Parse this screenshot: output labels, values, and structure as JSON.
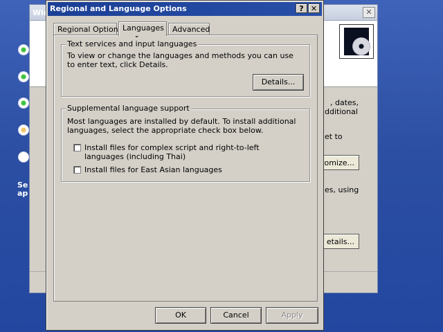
{
  "background_window": {
    "title": "Win",
    "close_glyph": "✕",
    "text_lines": [
      ", dates,",
      "dditional",
      "et to"
    ],
    "customize_label": "stomize...",
    "using_text": "es, using",
    "details_label": "etails...",
    "left_text_lines": [
      "Se",
      "ap"
    ]
  },
  "dialog": {
    "title": "Regional and Language Options",
    "help_glyph": "?",
    "close_glyph": "✕",
    "tabs": [
      {
        "label": "Regional Options"
      },
      {
        "label": "Languages"
      },
      {
        "label": "Advanced"
      }
    ],
    "text_services": {
      "legend": "Text services and input languages",
      "description": "To view or change the languages and methods you can use to enter text, click Details.",
      "details_label": "Details..."
    },
    "supplemental": {
      "legend": "Supplemental language support",
      "description": "Most languages are installed by default. To install additional languages, select the appropriate check box below.",
      "checkbox_complex": "Install files for complex script and right-to-left languages (including Thai)",
      "checkbox_east_asian": "Install files for East Asian languages"
    },
    "buttons": {
      "ok": "OK",
      "cancel": "Cancel",
      "apply": "Apply"
    }
  },
  "icons": [
    "cd-setup-icon",
    "mouse-cursor-icon",
    "radio-bullet-icon"
  ],
  "colors": {
    "desktop_blue": "#2c4fa3",
    "title_bar": "#1c3f95",
    "dialog_face": "#d4d0c8"
  }
}
